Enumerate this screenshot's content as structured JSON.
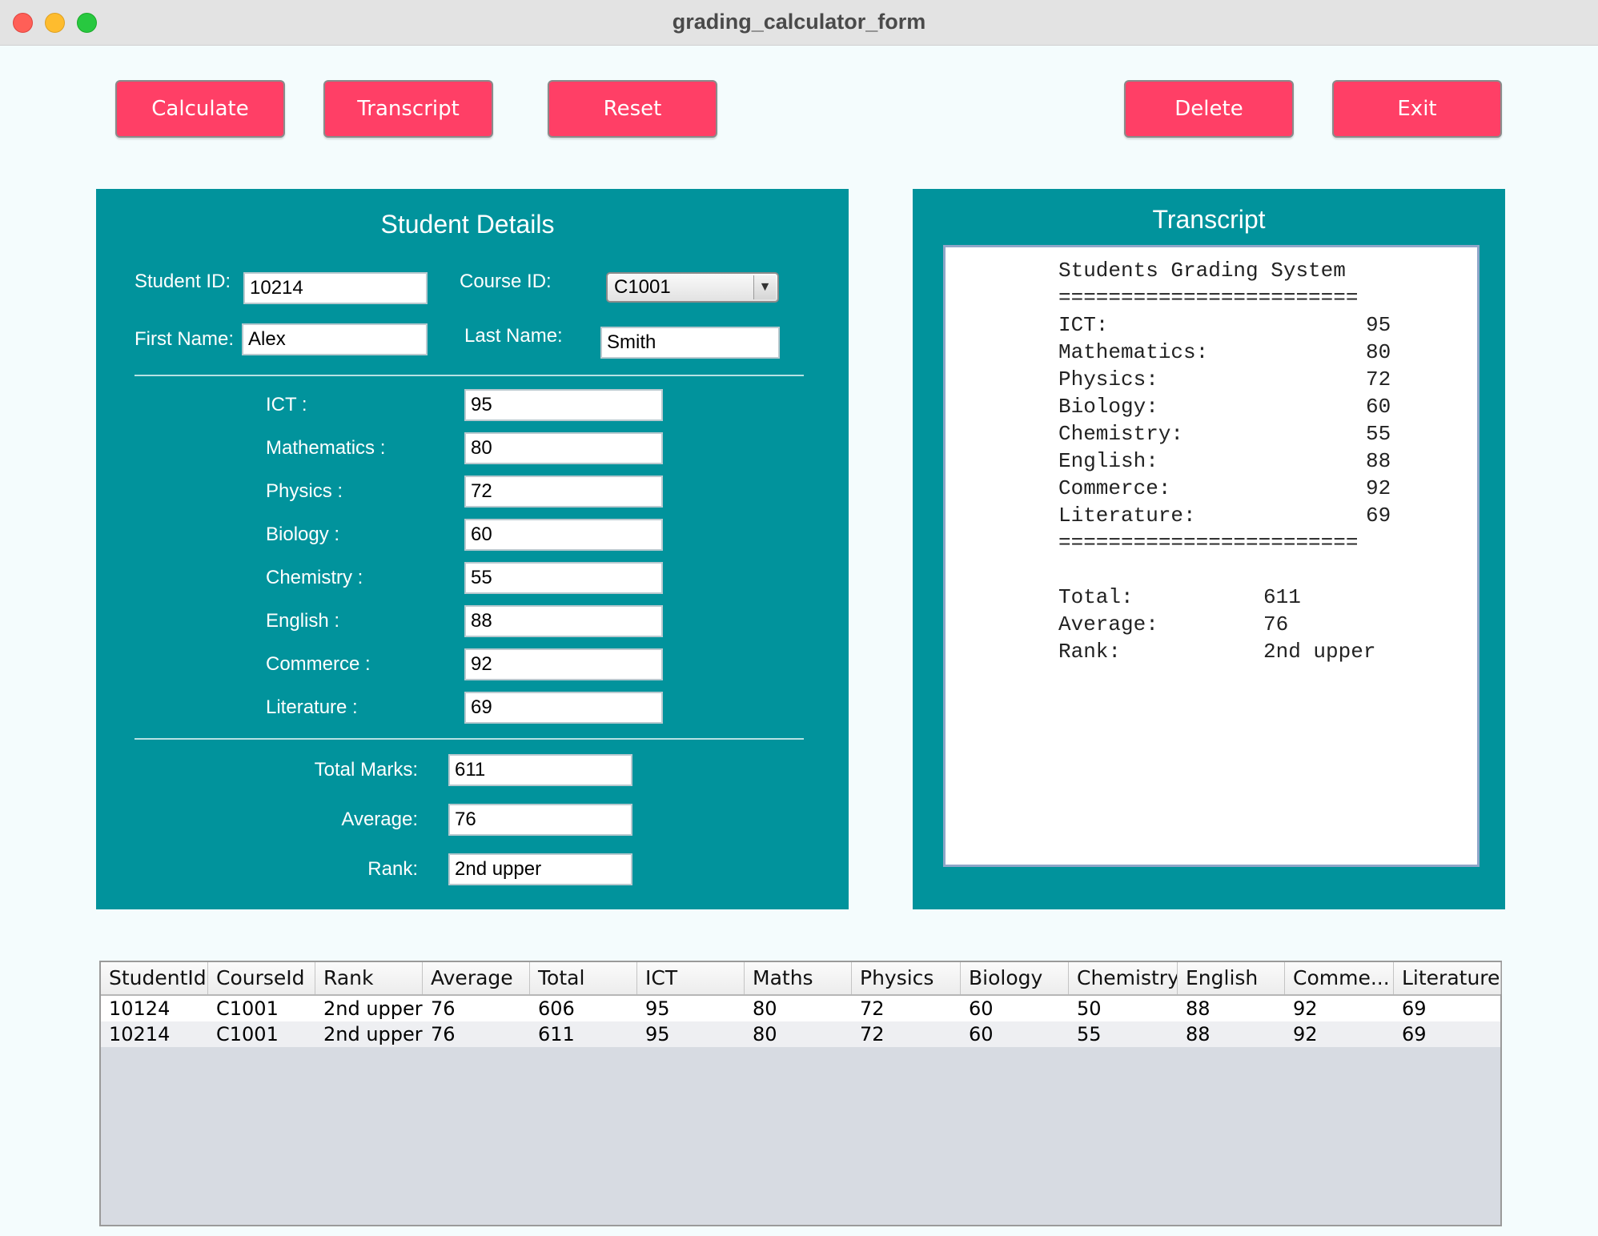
{
  "window": {
    "title": "grading_calculator_form"
  },
  "toolbar": {
    "calculate": "Calculate",
    "transcript": "Transcript",
    "reset": "Reset",
    "delete": "Delete",
    "exit": "Exit"
  },
  "details": {
    "title": "Student Details",
    "student_id_label": "Student ID:",
    "student_id": "10214",
    "course_id_label": "Course ID:",
    "course_id": "C1001",
    "first_name_label": "First Name:",
    "first_name": "Alex",
    "last_name_label": "Last Name:",
    "last_name": "Smith",
    "subjects": [
      {
        "label": "ICT :",
        "value": "95"
      },
      {
        "label": "Mathematics :",
        "value": "80"
      },
      {
        "label": "Physics :",
        "value": "72"
      },
      {
        "label": "Biology :",
        "value": "60"
      },
      {
        "label": "Chemistry :",
        "value": "55"
      },
      {
        "label": "English :",
        "value": "88"
      },
      {
        "label": "Commerce :",
        "value": "92"
      },
      {
        "label": "Literature :",
        "value": "69"
      }
    ],
    "total_label": "Total Marks:",
    "total": "611",
    "average_label": "Average:",
    "average": "76",
    "rank_label": "Rank:",
    "rank": "2nd upper"
  },
  "transcript": {
    "title": "Transcript",
    "heading": "Students Grading System",
    "separator": "========================",
    "subjects": [
      {
        "name": "ICT:",
        "score": "95"
      },
      {
        "name": "Mathematics:",
        "score": "80"
      },
      {
        "name": "Physics:",
        "score": "72"
      },
      {
        "name": "Biology:",
        "score": "60"
      },
      {
        "name": "Chemistry:",
        "score": "55"
      },
      {
        "name": "English:",
        "score": "88"
      },
      {
        "name": "Commerce:",
        "score": "92"
      },
      {
        "name": "Literature:",
        "score": "69"
      }
    ],
    "total_label": "Total:",
    "total": "611",
    "average_label": "Average:",
    "average": "76",
    "rank_label": "Rank:",
    "rank": "2nd upper"
  },
  "table": {
    "columns": [
      "StudentId",
      "CourseId",
      "Rank",
      "Average",
      "Total",
      "ICT",
      "Maths",
      "Physics",
      "Biology",
      "Chemistry",
      "English",
      "Comme...",
      "Literature"
    ],
    "rows": [
      [
        "10124",
        "C1001",
        "2nd upper",
        "76",
        "606",
        "95",
        "80",
        "72",
        "60",
        "50",
        "88",
        "92",
        "69"
      ],
      [
        "10214",
        "C1001",
        "2nd upper",
        "76",
        "611",
        "95",
        "80",
        "72",
        "60",
        "55",
        "88",
        "92",
        "69"
      ]
    ]
  }
}
